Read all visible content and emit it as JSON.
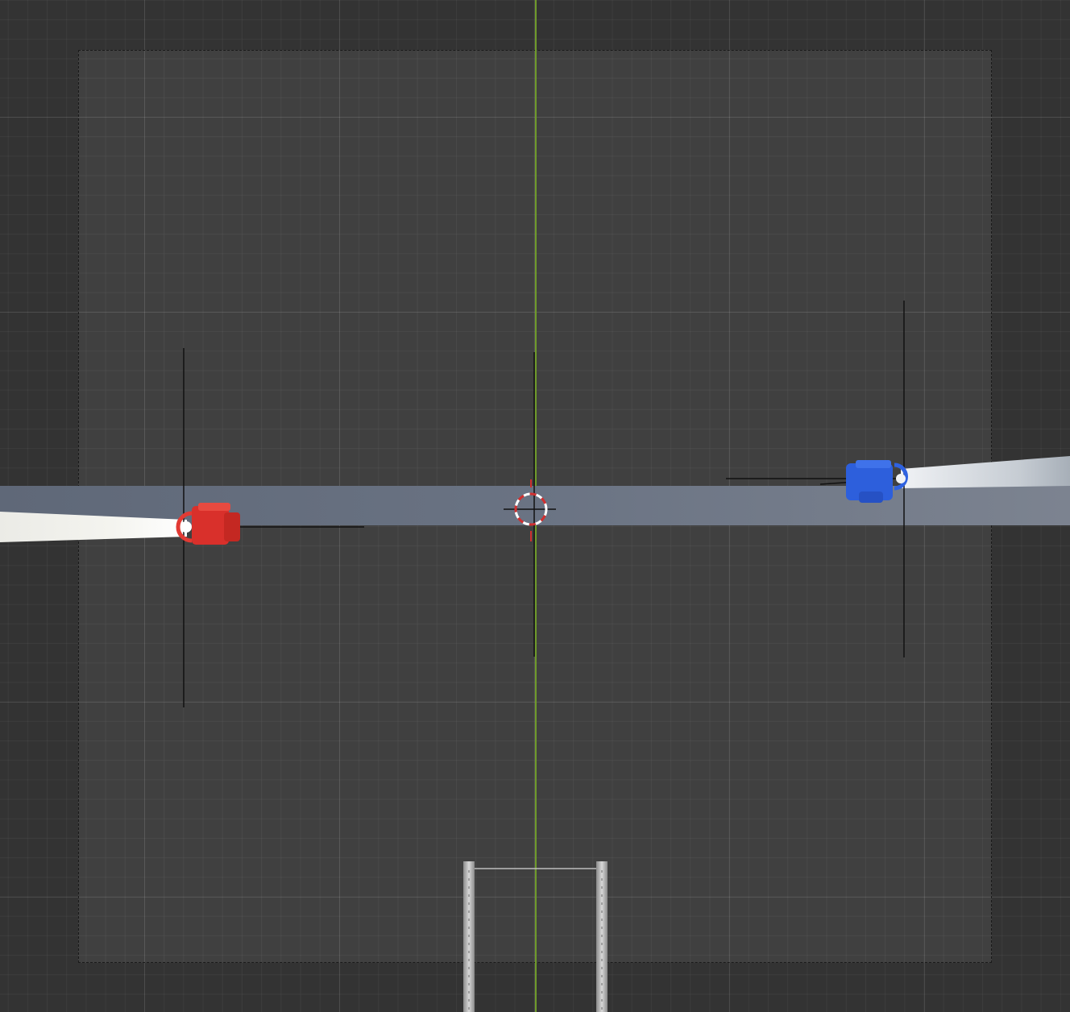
{
  "viewport": {
    "background_color": "#333333",
    "grid_color": "#4a4a4a",
    "y_axis_color": "#6f9a2a"
  },
  "scene": {
    "objects": [
      {
        "name": "red-car",
        "color": "#e23a33",
        "icon": "car-icon"
      },
      {
        "name": "blue-car",
        "color": "#2f62e0",
        "icon": "car-icon"
      },
      {
        "name": "road-lane",
        "color": "#737c8a"
      },
      {
        "name": "3d-cursor",
        "icon": "crosshair-icon",
        "ring_colors": [
          "#ffffff",
          "#d03030"
        ]
      },
      {
        "name": "goal-posts",
        "color": "#b8b8b8"
      }
    ]
  }
}
